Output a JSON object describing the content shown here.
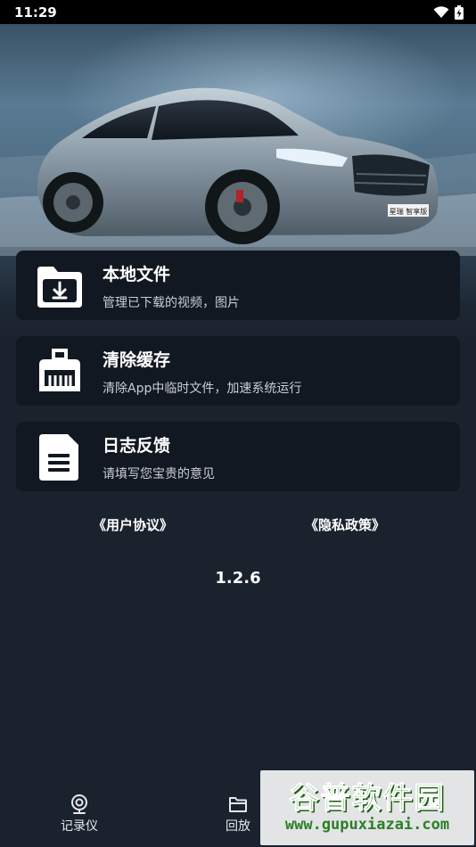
{
  "status_bar": {
    "time": "11:29"
  },
  "cards": [
    {
      "title": "本地文件",
      "subtitle": "管理已下载的视频，图片"
    },
    {
      "title": "清除缓存",
      "subtitle": "清除App中临时文件，加速系统运行"
    },
    {
      "title": "日志反馈",
      "subtitle": "请填写您宝贵的意见"
    }
  ],
  "links": {
    "user_agreement": "《用户协议》",
    "privacy_policy": "《隐私政策》"
  },
  "version": "1.2.6",
  "bottom_nav": [
    {
      "label": "记录仪",
      "icon": "camera-icon"
    },
    {
      "label": "回放",
      "icon": "folder-icon"
    }
  ],
  "watermark": {
    "title": "谷普软件园",
    "url": "www.gupuxiazai.com"
  },
  "car_plate": "星瑞 智享版",
  "colors": {
    "background": "#1a222e",
    "card": "#121821",
    "watermark_green": "#3a9a2b"
  }
}
